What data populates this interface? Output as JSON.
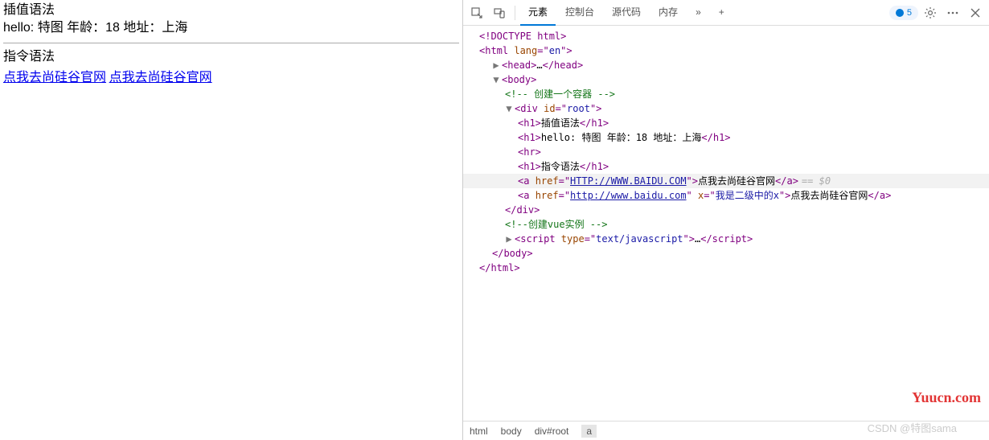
{
  "page": {
    "h1_interp": "插值语法",
    "h1_hello": "hello: 特图 年龄：18 地址：上海",
    "h1_directive": "指令语法",
    "link1": "点我去尚硅谷官网",
    "link2": "点我去尚硅谷官网"
  },
  "devtools": {
    "tabs": {
      "elements": "元素",
      "console": "控制台",
      "sources": "源代码",
      "memory": "内存"
    },
    "overflow": "»",
    "add": "+",
    "issues_count": "5",
    "breadcrumb": {
      "html": "html",
      "body": "body",
      "divroot": "div#root",
      "a": "a"
    }
  },
  "dom": {
    "doctype": "<!DOCTYPE html>",
    "html_open": "<html lang=\"en\">",
    "head": "<head>…</head>",
    "body_open": "<body>",
    "comment1": "<!-- 创建一个容器 -->",
    "div_open": "<div id=\"root\">",
    "h1a_o": "<h1>",
    "h1a_t": "插值语法",
    "h1a_c": "</h1>",
    "h1b_o": "<h1>",
    "h1b_t": "hello: 特图 年龄：18 地址：上海",
    "h1b_c": "</h1>",
    "hr": "<hr>",
    "h1c_o": "<h1>",
    "h1c_t": "指令语法",
    "h1c_c": "</h1>",
    "a1_pre": "<a href=\"",
    "a1_href": "HTTP://WWW.BAIDU.COM",
    "a1_mid": "\">",
    "a1_txt": "点我去尚硅谷官网",
    "a1_c": "</a>",
    "a1_meta": "== $0",
    "a2_pre": "<a href=\"",
    "a2_href": "http://www.baidu.com",
    "a2_mid": "\" x=\"",
    "a2_x": "我是二级中的x",
    "a2_mid2": "\">",
    "a2_txt": "点我去尚硅谷官网",
    "a2_c": "</a>",
    "div_close": "</div>",
    "comment2": "<!--创建vue实例 -->",
    "script_o": "<script type=\"text/javascript\">",
    "script_dots": "…",
    "script_c": "</scr_ipt>",
    "body_close": "</body>",
    "html_close": "</html>"
  },
  "watermark": {
    "yuucn": "Yuucn.com",
    "csdn": "CSDN @特图sama"
  }
}
